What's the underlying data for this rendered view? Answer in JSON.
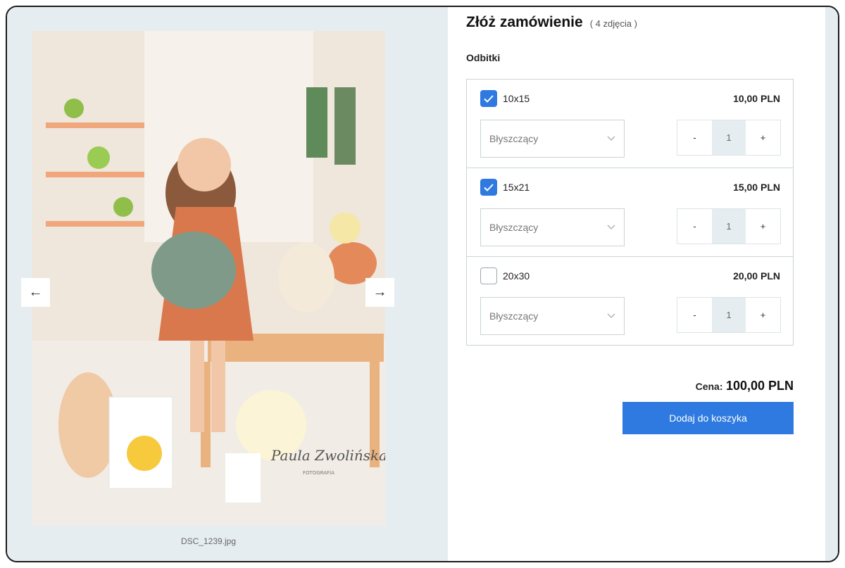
{
  "gallery": {
    "filename": "DSC_1239.jpg",
    "prev_icon": "arrow-left-icon",
    "next_icon": "arrow-right-icon",
    "watermark": "Paula Zwolińska",
    "watermark_sub": "FOTOGRAFIA"
  },
  "order": {
    "title": "Złóż zamówienie",
    "count": "( 4 zdjęcia )",
    "section_label": "Odbitki",
    "options": [
      {
        "size": "10x15",
        "price": "10,00 PLN",
        "checked": true,
        "finish": "Błyszczący",
        "quantity": "1"
      },
      {
        "size": "15x21",
        "price": "15,00 PLN",
        "checked": true,
        "finish": "Błyszczący",
        "quantity": "1"
      },
      {
        "size": "20x30",
        "price": "20,00 PLN",
        "checked": false,
        "finish": "Błyszczący",
        "quantity": "1"
      }
    ],
    "minus": "-",
    "plus": "+",
    "price_label": "Cena:",
    "price_value": "100,00 PLN",
    "add_button": "Dodaj do koszyka"
  },
  "colors": {
    "accent": "#2f7ae0",
    "panel": "#e6edf0",
    "border": "#c9d4d7"
  }
}
